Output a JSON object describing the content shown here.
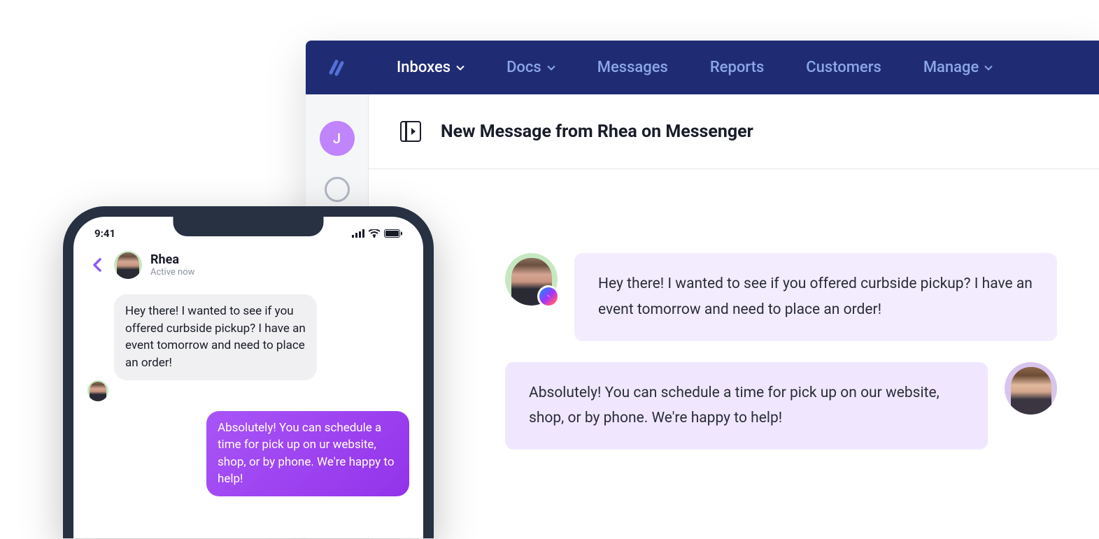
{
  "nav": {
    "items": [
      "Inboxes",
      "Docs",
      "Messages",
      "Reports",
      "Customers",
      "Manage"
    ],
    "activeIndex": 0
  },
  "sidebar": {
    "avatarLetter": "J"
  },
  "header": {
    "title": "New Message from Rhea on Messenger"
  },
  "conversation": {
    "incoming": "Hey there! I wanted to see if you offered curbside pickup? I have an event tomorrow and need to place an order!",
    "outgoing": "Absolutely! You can schedule a time for pick up on our website, shop, or by phone. We're happy to help!"
  },
  "phone": {
    "time": "9:41",
    "contact": {
      "name": "Rhea",
      "status": "Active now"
    },
    "messages": {
      "incoming": "Hey there! I wanted to see if you offered curbside pickup? I have an event tomorrow and need to place an order!",
      "outgoing": "Absolutely! You can schedule a time for pick up on ur website, shop, or by phone. We're happy to help!"
    }
  }
}
